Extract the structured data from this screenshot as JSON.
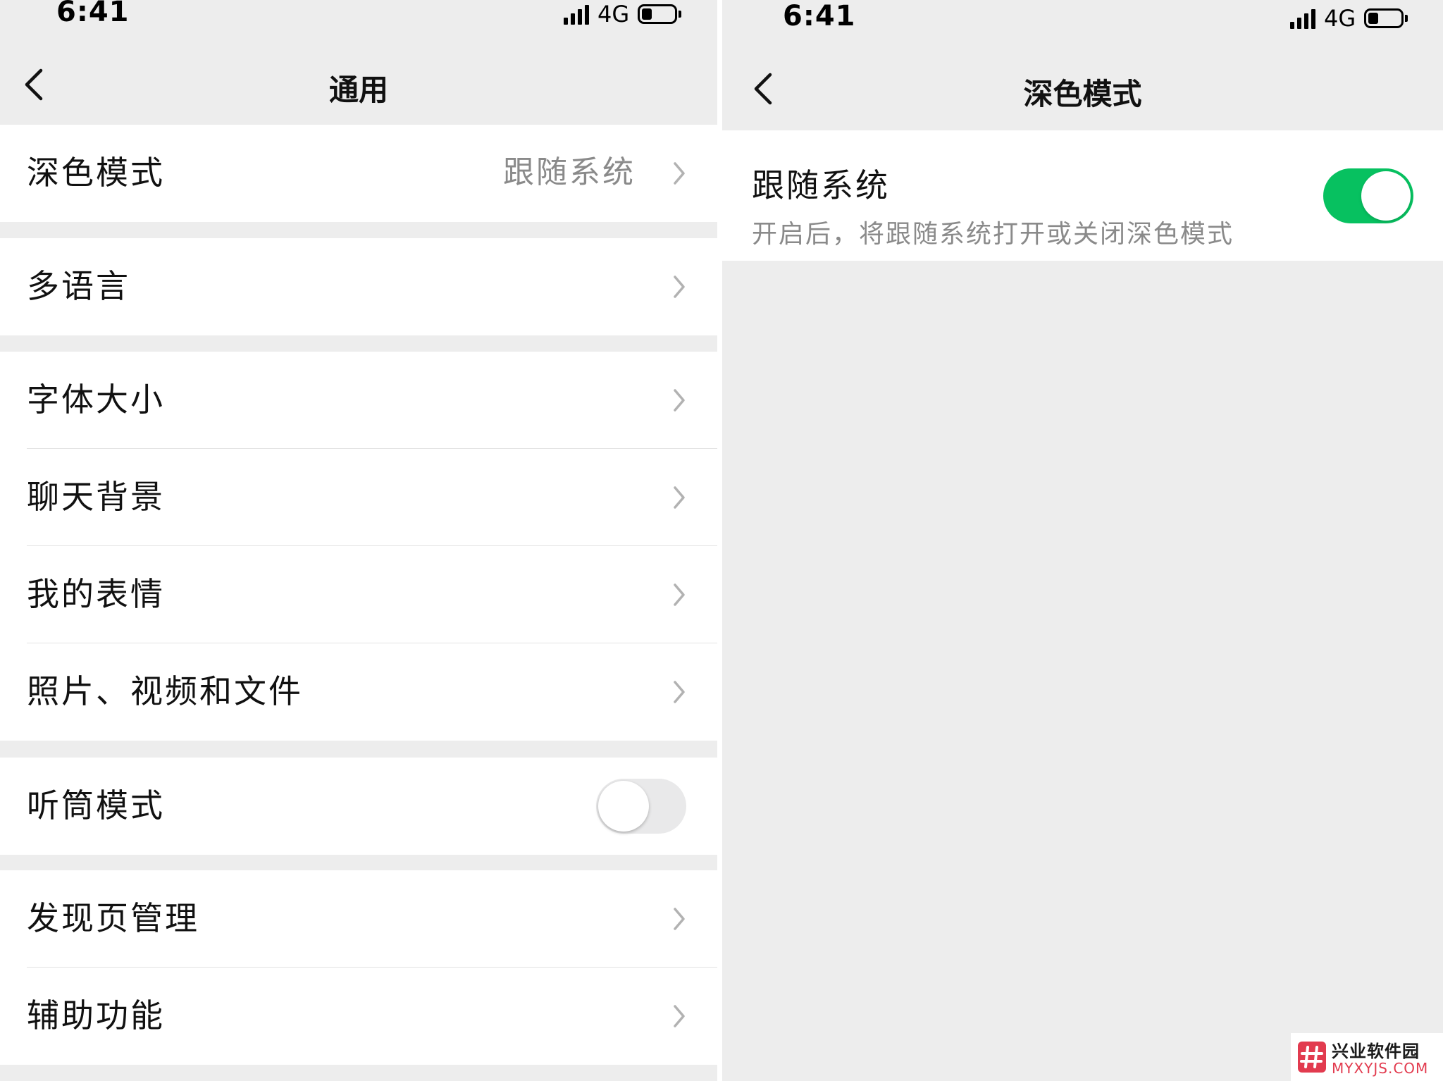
{
  "colors": {
    "background": "#ededed",
    "card": "#ffffff",
    "primary_text": "#111111",
    "secondary_text": "#8a8a8a",
    "toggle_on": "#07c160",
    "toggle_off": "#e9e9ea",
    "watermark_accent": "#e23b4f"
  },
  "left_screen": {
    "status_bar": {
      "time": "6:41",
      "network": "4G",
      "icons": [
        "signal-icon",
        "battery-icon"
      ]
    },
    "nav": {
      "title": "通用",
      "back_icon": "chevron-left-icon"
    },
    "groups": [
      [
        {
          "label": "深色模式",
          "value": "跟随系统",
          "accessory": "chevron-right-icon"
        }
      ],
      [
        {
          "label": "多语言",
          "accessory": "chevron-right-icon"
        }
      ],
      [
        {
          "label": "字体大小",
          "accessory": "chevron-right-icon"
        },
        {
          "label": "聊天背景",
          "accessory": "chevron-right-icon"
        },
        {
          "label": "我的表情",
          "accessory": "chevron-right-icon"
        },
        {
          "label": "照片、视频和文件",
          "accessory": "chevron-right-icon"
        }
      ],
      [
        {
          "label": "听筒模式",
          "accessory": "toggle",
          "toggle_on": false
        }
      ],
      [
        {
          "label": "发现页管理",
          "accessory": "chevron-right-icon"
        },
        {
          "label": "辅助功能",
          "accessory": "chevron-right-icon"
        }
      ]
    ]
  },
  "right_screen": {
    "status_bar": {
      "time": "6:41",
      "network": "4G",
      "icons": [
        "signal-icon",
        "battery-icon"
      ]
    },
    "nav": {
      "title": "深色模式",
      "back_icon": "chevron-left-icon"
    },
    "follow_system": {
      "label": "跟随系统",
      "description": "开启后，将跟随系统打开或关闭深色模式",
      "toggle_on": true
    }
  },
  "watermark": {
    "name": "兴业软件园",
    "domain": "MYXYJS.COM",
    "icon": "hash-logo-icon"
  }
}
